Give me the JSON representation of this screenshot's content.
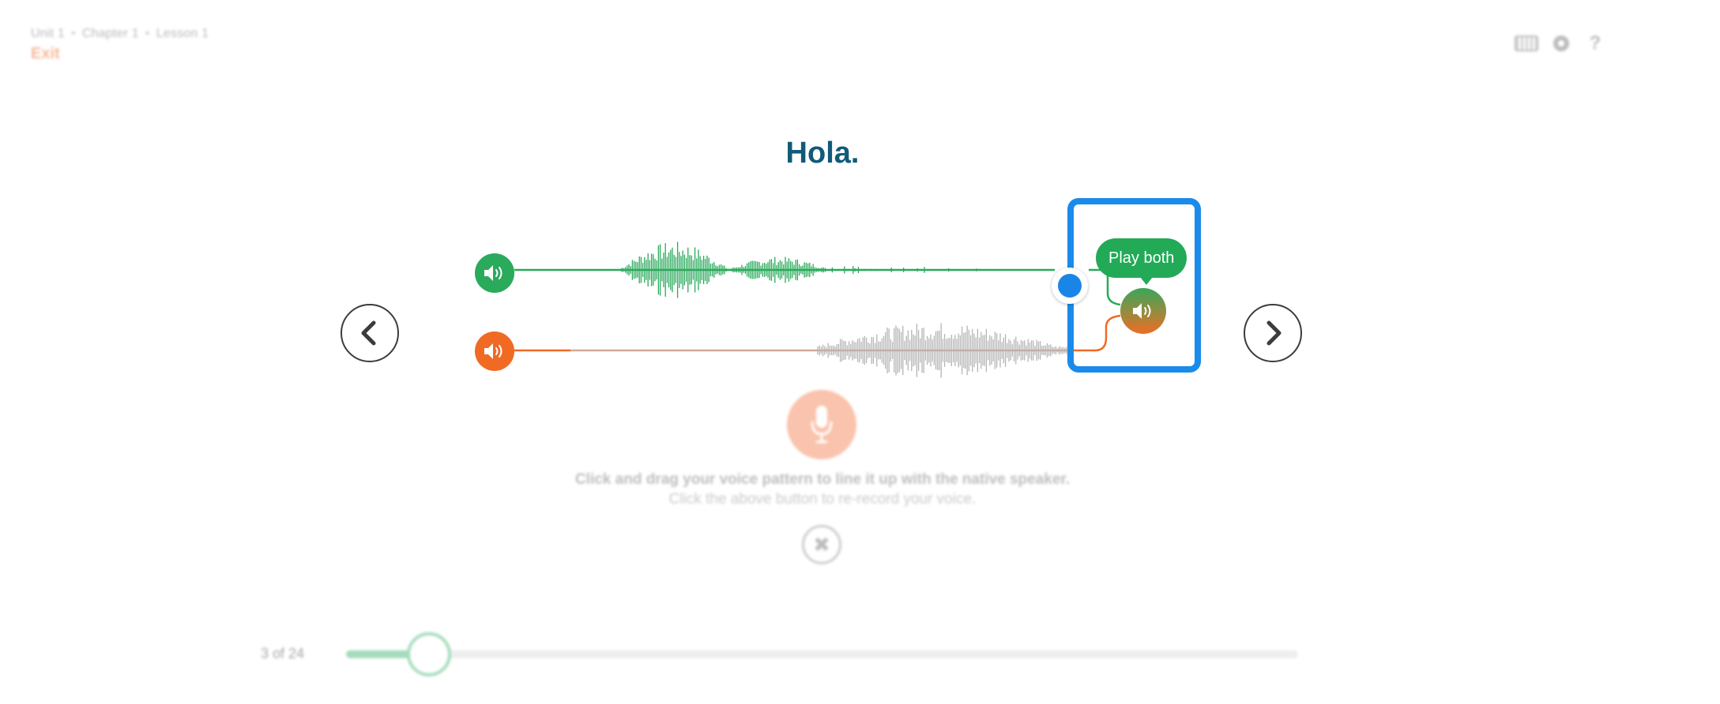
{
  "header": {
    "breadcrumb": [
      "Unit 1",
      "Chapter 1",
      "Lesson 1"
    ],
    "exit_label": "Exit",
    "help_label": "?"
  },
  "icons": {
    "keyboard": "keyboard-icon",
    "settings": "gear-icon",
    "help": "help-icon",
    "prev": "chevron-left-icon",
    "next": "chevron-right-icon",
    "native_audio": "speaker-icon",
    "user_audio": "speaker-icon",
    "play_both": "speaker-icon",
    "record": "microphone-icon",
    "close": "close-icon"
  },
  "lesson": {
    "phrase": "Hola.",
    "play_both_label": "Play both",
    "instruction": "Click and drag your voice pattern to line it up with the native speaker.",
    "sub_instruction": "Click the above button to re-record your voice.",
    "close_symbol": "✖"
  },
  "progress": {
    "label": "3 of 24",
    "current": 3,
    "total": 24,
    "fraction": 0.087
  },
  "colors": {
    "native": "#2aaa5b",
    "user": "#f06a24",
    "highlight": "#1a8bea",
    "phrase": "#115a79",
    "user_wave": "#b5b5b5"
  }
}
